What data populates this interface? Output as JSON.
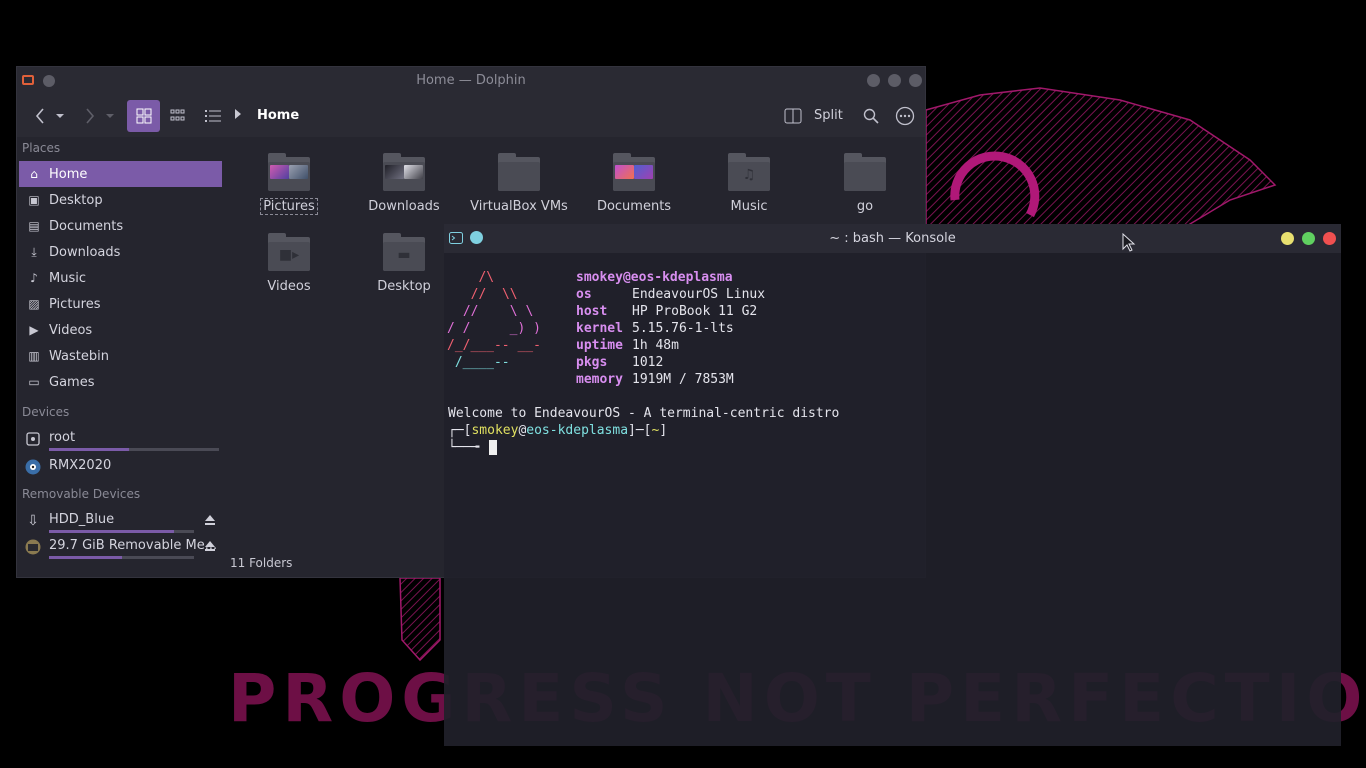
{
  "wallpaper": {
    "text": "PROGRESS NOT PERFECTION"
  },
  "dolphin": {
    "title": "Home — Dolphin",
    "toolbar": {
      "split_label": "Split",
      "breadcrumb": "Home"
    },
    "places_header": "Places",
    "places": [
      {
        "label": "Home",
        "icon": "home-icon",
        "selected": true
      },
      {
        "label": "Desktop",
        "icon": "desktop-icon"
      },
      {
        "label": "Documents",
        "icon": "document-icon"
      },
      {
        "label": "Downloads",
        "icon": "download-icon"
      },
      {
        "label": "Music",
        "icon": "music-icon"
      },
      {
        "label": "Pictures",
        "icon": "picture-icon"
      },
      {
        "label": "Videos",
        "icon": "video-icon"
      },
      {
        "label": "Wastebin",
        "icon": "trash-icon"
      },
      {
        "label": "Games",
        "icon": "folder-icon"
      }
    ],
    "devices_header": "Devices",
    "devices": [
      {
        "label": "root",
        "icon": "drive-icon",
        "usage": 0.42
      },
      {
        "label": "RMX2020",
        "icon": "phone-icon"
      }
    ],
    "removable_header": "Removable Devices",
    "removable": [
      {
        "label": "HDD_Blue",
        "icon": "usb-icon",
        "usage": 0.86
      },
      {
        "label": "29.7 GiB Removable Me...",
        "icon": "sdcard-icon",
        "usage": 0.5
      }
    ],
    "folders": [
      {
        "name": "Pictures",
        "kind": "thumbs"
      },
      {
        "name": "Downloads",
        "kind": "thumbs"
      },
      {
        "name": "VirtualBox VMs",
        "kind": "plain"
      },
      {
        "name": "Documents",
        "kind": "thumbs"
      },
      {
        "name": "Music",
        "kind": "music"
      },
      {
        "name": "go",
        "kind": "plain"
      },
      {
        "name": "Videos",
        "kind": "video"
      },
      {
        "name": "Desktop",
        "kind": "desktop"
      }
    ],
    "status": "11 Folders"
  },
  "konsole": {
    "title": "~ : bash — Konsole",
    "logo": [
      "   /\\",
      "  //  \\\\",
      " //    \\ \\",
      "/ /     _) )",
      "/_/___-- __-",
      " /____--"
    ],
    "user": "smokey",
    "host": "eos-kdeplasma",
    "user_host": "smokey@eos-kdeplasma",
    "info": [
      {
        "key": "os",
        "value": "EndeavourOS Linux"
      },
      {
        "key": "host",
        "value": "HP ProBook 11 G2"
      },
      {
        "key": "kernel",
        "value": "5.15.76-1-lts"
      },
      {
        "key": "uptime",
        "value": "1h 48m"
      },
      {
        "key": "pkgs",
        "value": "1012"
      },
      {
        "key": "memory",
        "value": "1919M / 7853M"
      }
    ],
    "welcome": "Welcome to EndeavourOS - A terminal-centric distro",
    "prompt": {
      "open": "┌─[",
      "at": "@",
      "mid": "]─[",
      "dir": "~",
      "close": "]",
      "second": "└──╼"
    }
  }
}
